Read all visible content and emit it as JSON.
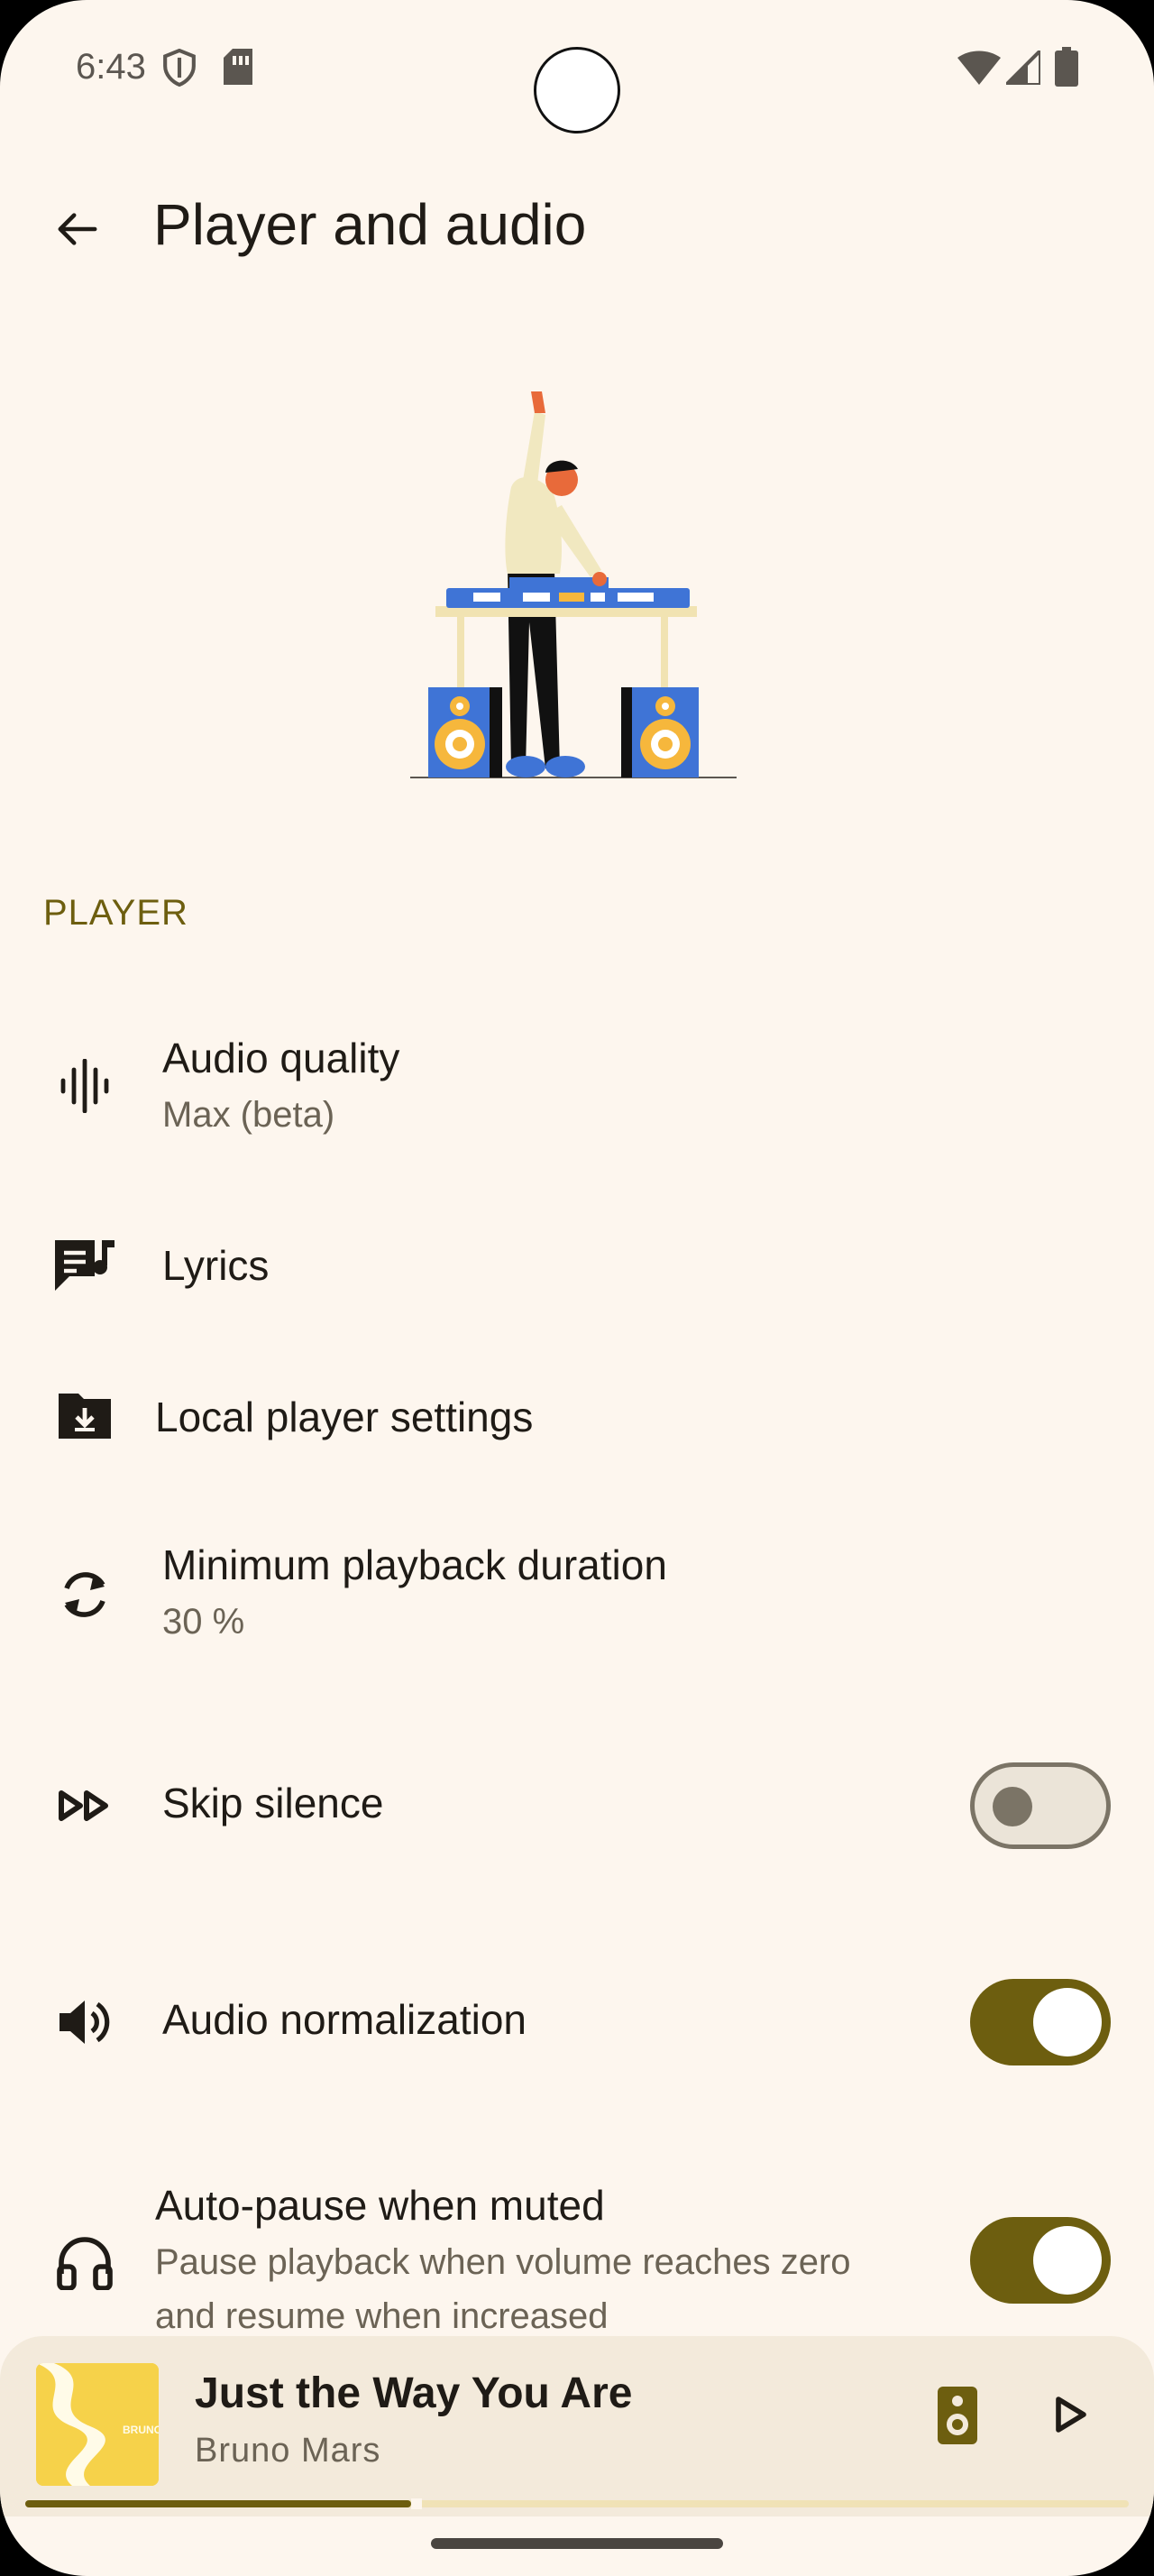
{
  "status_bar": {
    "time": "6:43",
    "icons": [
      "shield-icon",
      "sim-card-icon",
      "wifi-icon",
      "signal-icon",
      "battery-icon"
    ]
  },
  "app_bar": {
    "back_icon": "arrow-back-icon",
    "title": "Player and audio"
  },
  "section": {
    "header": "PLAYER"
  },
  "settings": {
    "audio_quality": {
      "title": "Audio quality",
      "subtitle": "Max (beta)",
      "icon": "graphic-eq-icon"
    },
    "lyrics": {
      "title": "Lyrics",
      "icon": "lyrics-icon"
    },
    "local_player": {
      "title": "Local player settings",
      "icon": "folder-download-icon"
    },
    "min_playback": {
      "title": "Minimum playback duration",
      "subtitle": "30 %",
      "icon": "sync-icon"
    },
    "skip_silence": {
      "title": "Skip silence",
      "icon": "fast-forward-icon",
      "enabled": false
    },
    "normalization": {
      "title": "Audio normalization",
      "icon": "volume-up-icon",
      "enabled": true
    },
    "auto_pause": {
      "title": "Auto-pause when muted",
      "subtitle_line1": "Pause playback when volume reaches zero",
      "subtitle_line2": "and resume when increased",
      "icon": "headphones-icon",
      "enabled": true
    }
  },
  "mini_player": {
    "title": "Just the Way You Are",
    "artist": "Bruno Mars",
    "album_art_text": "BRUNO MARS",
    "progress": 0.35,
    "speaker_icon": "speaker-icon",
    "play_icon": "play-icon"
  },
  "colors": {
    "background": "#fdf6ee",
    "accent": "#6d5e0f",
    "text_primary": "#1f1b16",
    "text_secondary": "#6b6355",
    "player_bg": "#f3eadb"
  }
}
